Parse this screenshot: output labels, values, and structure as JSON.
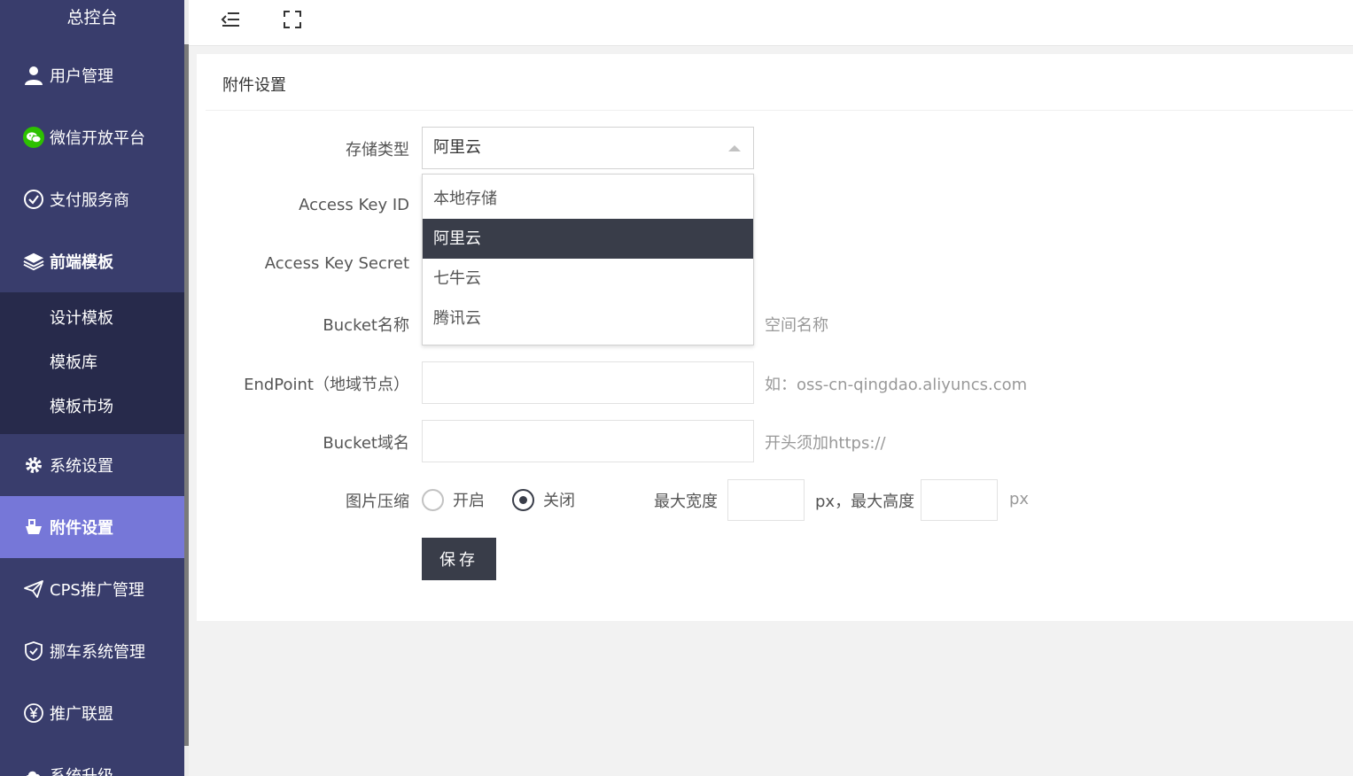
{
  "sidebar": {
    "title": "总控台",
    "items": [
      {
        "label": "用户管理",
        "icon": "user-icon"
      },
      {
        "label": "微信开放平台",
        "icon": "wechat-icon"
      },
      {
        "label": "支付服务商",
        "icon": "check-circle-icon"
      },
      {
        "label": "前端模板",
        "icon": "layers-icon"
      },
      {
        "label": "系统设置",
        "icon": "gear-icon"
      },
      {
        "label": "附件设置",
        "icon": "ship-icon"
      },
      {
        "label": "CPS推广管理",
        "icon": "paper-plane-icon"
      },
      {
        "label": "挪车系统管理",
        "icon": "shield-icon"
      },
      {
        "label": "推广联盟",
        "icon": "yen-icon"
      },
      {
        "label": "系统升级",
        "icon": "cloud-icon"
      }
    ],
    "submenu": [
      "设计模板",
      "模板库",
      "模板市场"
    ],
    "active_color": "#7677d8"
  },
  "header": {
    "menu_toggle_icon": "menu-fold-icon",
    "fullscreen_icon": "fullscreen-icon"
  },
  "form": {
    "title": "附件设置",
    "storage_label": "存储类型",
    "storage_value": "阿里云",
    "storage_options": [
      "本地存储",
      "阿里云",
      "七牛云",
      "腾讯云"
    ],
    "access_key_id_label": "Access Key ID",
    "access_key_secret_label": "Access Key Secret",
    "bucket_name_label": "Bucket名称",
    "bucket_name_hint": "空间名称",
    "endpoint_label": "EndPoint（地域节点）",
    "endpoint_hint": "如：oss-cn-qingdao.aliyuncs.com",
    "bucket_domain_label": "Bucket域名",
    "bucket_domain_hint": "开头须加https://",
    "compress_label": "图片压缩",
    "compress_on": "开启",
    "compress_off": "关闭",
    "compress_selected": "关闭",
    "max_width_label": "最大宽度",
    "max_height_label": "px，最大高度",
    "px_unit": "px",
    "save_label": "保存"
  }
}
